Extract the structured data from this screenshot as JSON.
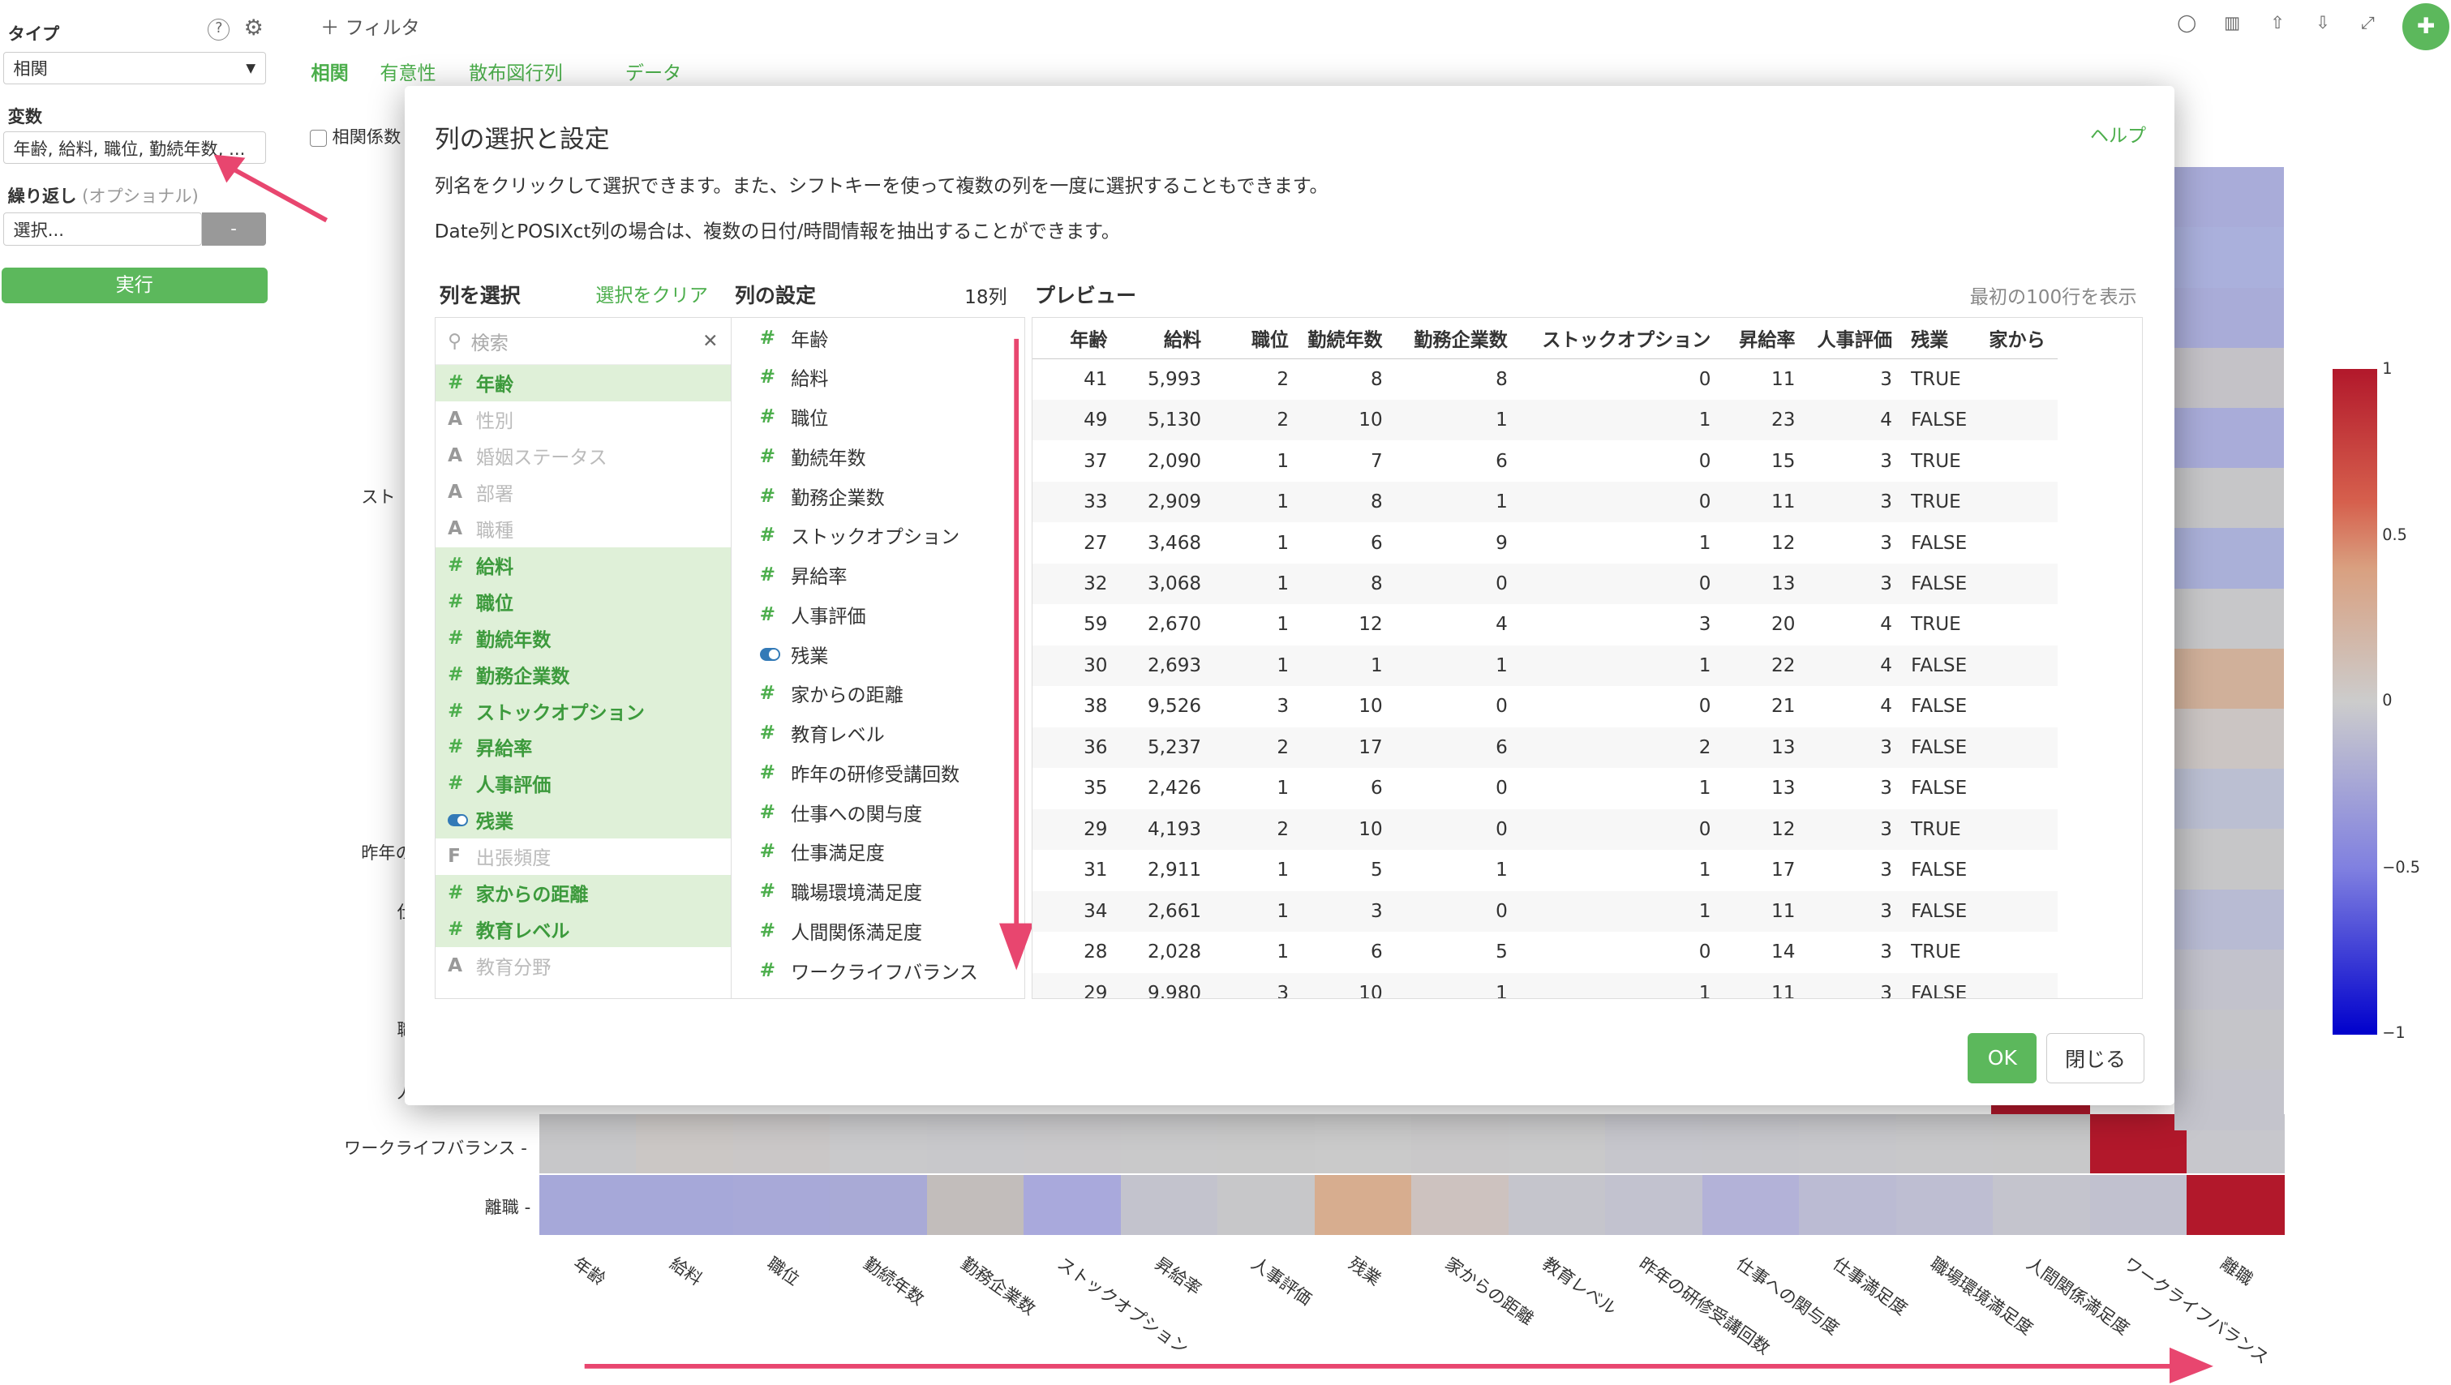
{
  "sidebar": {
    "type_label": "タイプ",
    "type_value": "相関",
    "var_label": "変数",
    "var_value": "年齢, 給料, 職位, 勤続年数, ...",
    "repeat_label": "繰り返し",
    "repeat_optional": "(オプショナル)",
    "repeat_placeholder": "選択...",
    "repeat_btn": "-",
    "run_btn": "実行"
  },
  "topbar": {
    "filter_label": "フィルタ",
    "chart_tabs": [
      "相関",
      "有意性",
      "散布図行列",
      "データ"
    ],
    "corr_checkbox_label": "相関係数",
    "active_tab": "相関"
  },
  "heatmap": {
    "y_labels_visible": [
      "スト",
      "昨年の",
      "仕",
      "職",
      "人",
      "ワークライフバランス",
      "離職"
    ],
    "x_labels": [
      "年齢",
      "給料",
      "職位",
      "勤続年数",
      "勤務企業数",
      "ストックオプション",
      "昇給率",
      "人事評価",
      "残業",
      "家からの距離",
      "教育レベル",
      "昨年の研修受講回数",
      "仕事への関与度",
      "仕事満足度",
      "職場環境満足度",
      "人間関係満足度",
      "ワークライフバランス",
      "離職"
    ],
    "legend_ticks": [
      "1",
      "0.5",
      "0",
      "−0.5",
      "−1"
    ],
    "colors": {
      "high": "#b2182b",
      "mid": "#c9c9c9",
      "low": "#0000cc"
    }
  },
  "modal": {
    "title": "列の選択と設定",
    "help": "ヘルプ",
    "desc1": "列名をクリックして選択できます。また、シフトキーを使って複数の列を一度に選択することもできます。",
    "desc2": "Date列とPOSIXct列の場合は、複数の日付/時間情報を抽出することができます。",
    "col_select_header": "列を選択",
    "clear_selection": "選択をクリア",
    "col_settings_header": "列の設定",
    "col_count": "18列",
    "preview_header": "プレビュー",
    "preview_note": "最初の100行を表示",
    "search_placeholder": "検索",
    "ok": "OK",
    "close": "閉じる",
    "column_list": [
      {
        "name": "年齢",
        "type": "#",
        "selected": true
      },
      {
        "name": "性別",
        "type": "A",
        "selected": false
      },
      {
        "name": "婚姻ステータス",
        "type": "A",
        "selected": false
      },
      {
        "name": "部署",
        "type": "A",
        "selected": false
      },
      {
        "name": "職種",
        "type": "A",
        "selected": false
      },
      {
        "name": "給料",
        "type": "#",
        "selected": true
      },
      {
        "name": "職位",
        "type": "#",
        "selected": true
      },
      {
        "name": "勤続年数",
        "type": "#",
        "selected": true
      },
      {
        "name": "勤務企業数",
        "type": "#",
        "selected": true
      },
      {
        "name": "ストックオプション",
        "type": "#",
        "selected": true
      },
      {
        "name": "昇給率",
        "type": "#",
        "selected": true
      },
      {
        "name": "人事評価",
        "type": "#",
        "selected": true
      },
      {
        "name": "残業",
        "type": "toggle",
        "selected": true
      },
      {
        "name": "出張頻度",
        "type": "F",
        "selected": false
      },
      {
        "name": "家からの距離",
        "type": "#",
        "selected": true
      },
      {
        "name": "教育レベル",
        "type": "#",
        "selected": true
      },
      {
        "name": "教育分野",
        "type": "A",
        "selected": false
      }
    ],
    "settings_list": [
      {
        "name": "年齢",
        "type": "#"
      },
      {
        "name": "給料",
        "type": "#"
      },
      {
        "name": "職位",
        "type": "#"
      },
      {
        "name": "勤続年数",
        "type": "#"
      },
      {
        "name": "勤務企業数",
        "type": "#"
      },
      {
        "name": "ストックオプション",
        "type": "#"
      },
      {
        "name": "昇給率",
        "type": "#"
      },
      {
        "name": "人事評価",
        "type": "#"
      },
      {
        "name": "残業",
        "type": "toggle"
      },
      {
        "name": "家からの距離",
        "type": "#"
      },
      {
        "name": "教育レベル",
        "type": "#"
      },
      {
        "name": "昨年の研修受講回数",
        "type": "#"
      },
      {
        "name": "仕事への関与度",
        "type": "#"
      },
      {
        "name": "仕事満足度",
        "type": "#"
      },
      {
        "name": "職場環境満足度",
        "type": "#"
      },
      {
        "name": "人間関係満足度",
        "type": "#"
      },
      {
        "name": "ワークライフバランス",
        "type": "#"
      }
    ],
    "preview_columns": [
      "年齢",
      "給料",
      "職位",
      "勤続年数",
      "勤務企業数",
      "ストックオプション",
      "昇給率",
      "人事評価",
      "残業",
      "家から"
    ],
    "preview_rows": [
      [
        "41",
        "5,993",
        "2",
        "8",
        "8",
        "0",
        "11",
        "3",
        "TRUE",
        ""
      ],
      [
        "49",
        "5,130",
        "2",
        "10",
        "1",
        "1",
        "23",
        "4",
        "FALSE",
        ""
      ],
      [
        "37",
        "2,090",
        "1",
        "7",
        "6",
        "0",
        "15",
        "3",
        "TRUE",
        ""
      ],
      [
        "33",
        "2,909",
        "1",
        "8",
        "1",
        "0",
        "11",
        "3",
        "TRUE",
        ""
      ],
      [
        "27",
        "3,468",
        "1",
        "6",
        "9",
        "1",
        "12",
        "3",
        "FALSE",
        ""
      ],
      [
        "32",
        "3,068",
        "1",
        "8",
        "0",
        "0",
        "13",
        "3",
        "FALSE",
        ""
      ],
      [
        "59",
        "2,670",
        "1",
        "12",
        "4",
        "3",
        "20",
        "4",
        "TRUE",
        ""
      ],
      [
        "30",
        "2,693",
        "1",
        "1",
        "1",
        "1",
        "22",
        "4",
        "FALSE",
        ""
      ],
      [
        "38",
        "9,526",
        "3",
        "10",
        "0",
        "0",
        "21",
        "4",
        "FALSE",
        ""
      ],
      [
        "36",
        "5,237",
        "2",
        "17",
        "6",
        "2",
        "13",
        "3",
        "FALSE",
        ""
      ],
      [
        "35",
        "2,426",
        "1",
        "6",
        "0",
        "1",
        "13",
        "3",
        "FALSE",
        ""
      ],
      [
        "29",
        "4,193",
        "2",
        "10",
        "0",
        "0",
        "12",
        "3",
        "TRUE",
        ""
      ],
      [
        "31",
        "2,911",
        "1",
        "5",
        "1",
        "1",
        "17",
        "3",
        "FALSE",
        ""
      ],
      [
        "34",
        "2,661",
        "1",
        "3",
        "0",
        "1",
        "11",
        "3",
        "FALSE",
        ""
      ],
      [
        "28",
        "2,028",
        "1",
        "6",
        "5",
        "0",
        "14",
        "3",
        "TRUE",
        ""
      ],
      [
        "29",
        "9,980",
        "3",
        "10",
        "1",
        "1",
        "11",
        "3",
        "FALSE",
        ""
      ]
    ]
  }
}
